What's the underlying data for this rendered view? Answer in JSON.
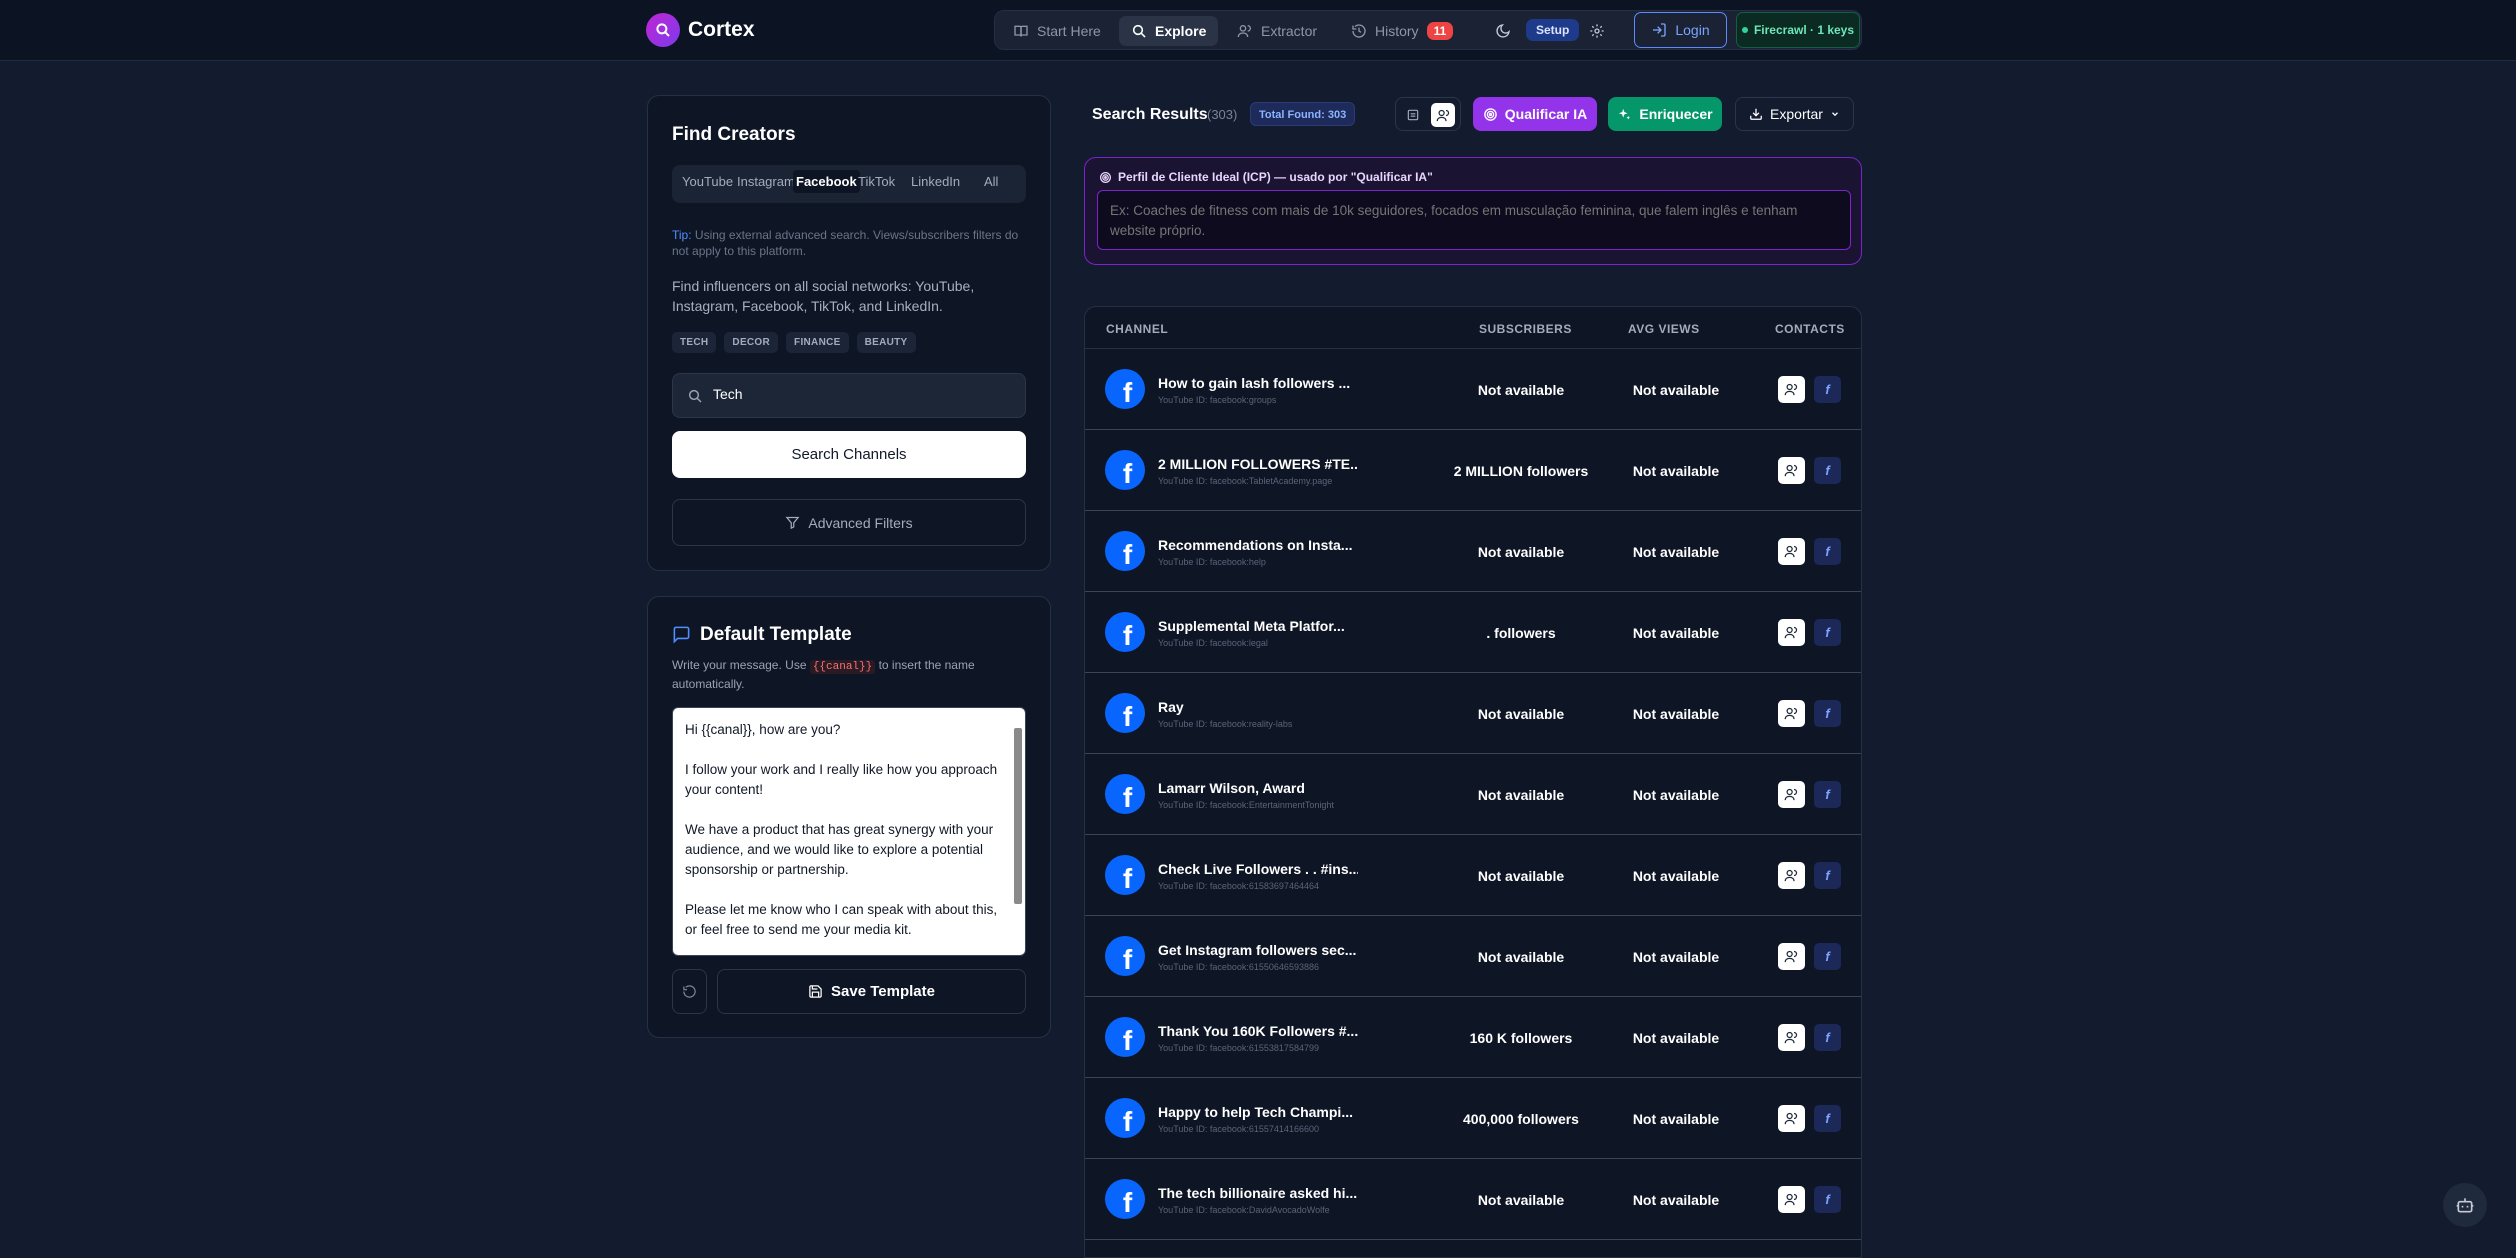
{
  "app": {
    "name": "Cortex"
  },
  "nav": {
    "start_here": "Start Here",
    "explore": "Explore",
    "extractor": "Extractor",
    "history": "History",
    "history_count": "11",
    "setup": "Setup",
    "login": "Login",
    "firecrawl": "Firecrawl · 1 keys"
  },
  "find": {
    "title": "Find Creators",
    "tabs": [
      "YouTube",
      "Instagram",
      "Facebook",
      "TikTok",
      "LinkedIn",
      "All"
    ],
    "active_tab": "Facebook",
    "tip_label": "Tip:",
    "tip_text": " Using external advanced search. Views/subscribers filters do not apply to this platform.",
    "description": "Find influencers on all social networks: YouTube, Instagram, Facebook, TikTok, and LinkedIn.",
    "tags": [
      "TECH",
      "DECOR",
      "FINANCE",
      "BEAUTY"
    ],
    "search_value": "Tech",
    "search_button": "Search Channels",
    "advanced_button": "Advanced Filters"
  },
  "template": {
    "title": "Default Template",
    "help_before": "Write your message. Use ",
    "help_code": "{{canal}}",
    "help_after": " to insert the name automatically.",
    "body": "Hi {{canal}}, how are you?\n\nI follow your work and I really like how you approach your content!\n\nWe have a product that has great synergy with your audience, and we would like to explore a potential sponsorship or partnership.\n\nPlease let me know who I can speak with about this, or feel free to send me your media kit.",
    "save_button": "Save Template"
  },
  "results": {
    "title": "Search Results",
    "count": "(303)",
    "total_found": "Total Found: 303",
    "qualify_button": "Qualificar IA",
    "enrich_button": "Enriquecer",
    "export_button": "Exportar",
    "icp_label": "Perfil de Cliente Ideal (ICP) — usado por \"Qualificar IA\"",
    "icp_placeholder": "Ex: Coaches de fitness com mais de 10k seguidores, focados em musculação feminina, que falem inglês e tenham website próprio.",
    "columns": [
      "CHANNEL",
      "SUBSCRIBERS",
      "AVG VIEWS",
      "CONTACTS"
    ],
    "rows": [
      {
        "name": "How to gain lash followers ...",
        "id": "YouTube ID: facebook:groups",
        "subscribers": "Not available",
        "avg_views": "Not available"
      },
      {
        "name": "2 MILLION FOLLOWERS #TE...",
        "id": "YouTube ID: facebook:TabletAcademy.page",
        "subscribers": "2 MILLION followers",
        "avg_views": "Not available"
      },
      {
        "name": "Recommendations on Insta...",
        "id": "YouTube ID: facebook:help",
        "subscribers": "Not available",
        "avg_views": "Not available"
      },
      {
        "name": "Supplemental Meta Platfor...",
        "id": "YouTube ID: facebook:legal",
        "subscribers": ". followers",
        "avg_views": "Not available"
      },
      {
        "name": "Ray",
        "id": "YouTube ID: facebook:reality-labs",
        "subscribers": "Not available",
        "avg_views": "Not available"
      },
      {
        "name": "Lamarr Wilson, Award",
        "id": "YouTube ID: facebook:EntertainmentTonight",
        "subscribers": "Not available",
        "avg_views": "Not available"
      },
      {
        "name": "Check Live Followers . . #ins...",
        "id": "YouTube ID: facebook:61583697464464",
        "subscribers": "Not available",
        "avg_views": "Not available"
      },
      {
        "name": "Get Instagram followers sec...",
        "id": "YouTube ID: facebook:61550646593886",
        "subscribers": "Not available",
        "avg_views": "Not available"
      },
      {
        "name": "Thank You 160K Followers #...",
        "id": "YouTube ID: facebook:61553817584799",
        "subscribers": "160 K followers",
        "avg_views": "Not available"
      },
      {
        "name": "Happy to help Tech Champi...",
        "id": "YouTube ID: facebook:61557414166600",
        "subscribers": "400,000 followers",
        "avg_views": "Not available"
      },
      {
        "name": "The tech billionaire asked hi...",
        "id": "YouTube ID: facebook:DavidAvocadoWolfe",
        "subscribers": "Not available",
        "avg_views": "Not available"
      }
    ]
  },
  "colors": {
    "accent_purple": "#9333ea",
    "accent_green": "#059669",
    "facebook_blue": "#0866ff"
  }
}
